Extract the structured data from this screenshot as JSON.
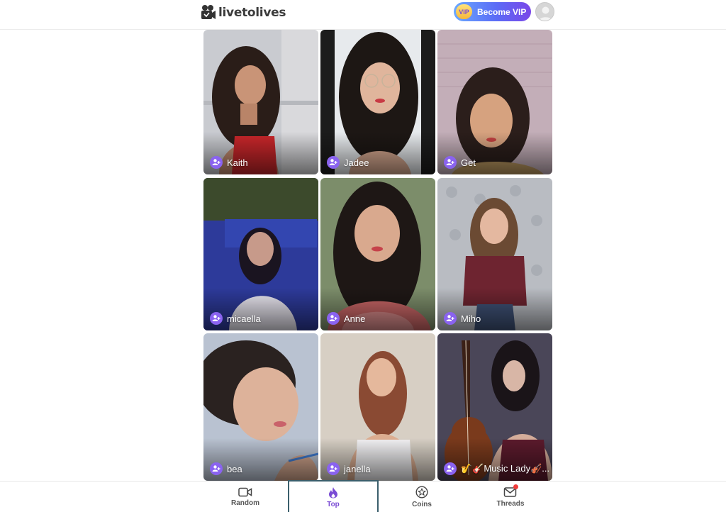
{
  "header": {
    "logo_text": "livetolives",
    "vip_badge": "VIP",
    "vip_button_label": "Become VIP"
  },
  "grid": {
    "cards": [
      {
        "name": "Kaith"
      },
      {
        "name": "Jadee"
      },
      {
        "name": "Get"
      },
      {
        "name": "micaella"
      },
      {
        "name": "Anne"
      },
      {
        "name": "Miho"
      },
      {
        "name": "bea"
      },
      {
        "name": "janella"
      },
      {
        "name": "🎷🎸Music Lady🎻..."
      }
    ]
  },
  "nav": {
    "tabs": [
      {
        "label": "Random",
        "icon": "video-camera-icon"
      },
      {
        "label": "Top",
        "icon": "flame-icon"
      },
      {
        "label": "Coins",
        "icon": "star-coin-icon"
      },
      {
        "label": "Threads",
        "icon": "mail-icon"
      }
    ],
    "active": "Top"
  },
  "colors": {
    "accent": "#8a63f0",
    "vip_gradient_start": "#6aa8ff",
    "vip_gradient_end": "#7a47e8",
    "notification": "#f03c3c"
  }
}
